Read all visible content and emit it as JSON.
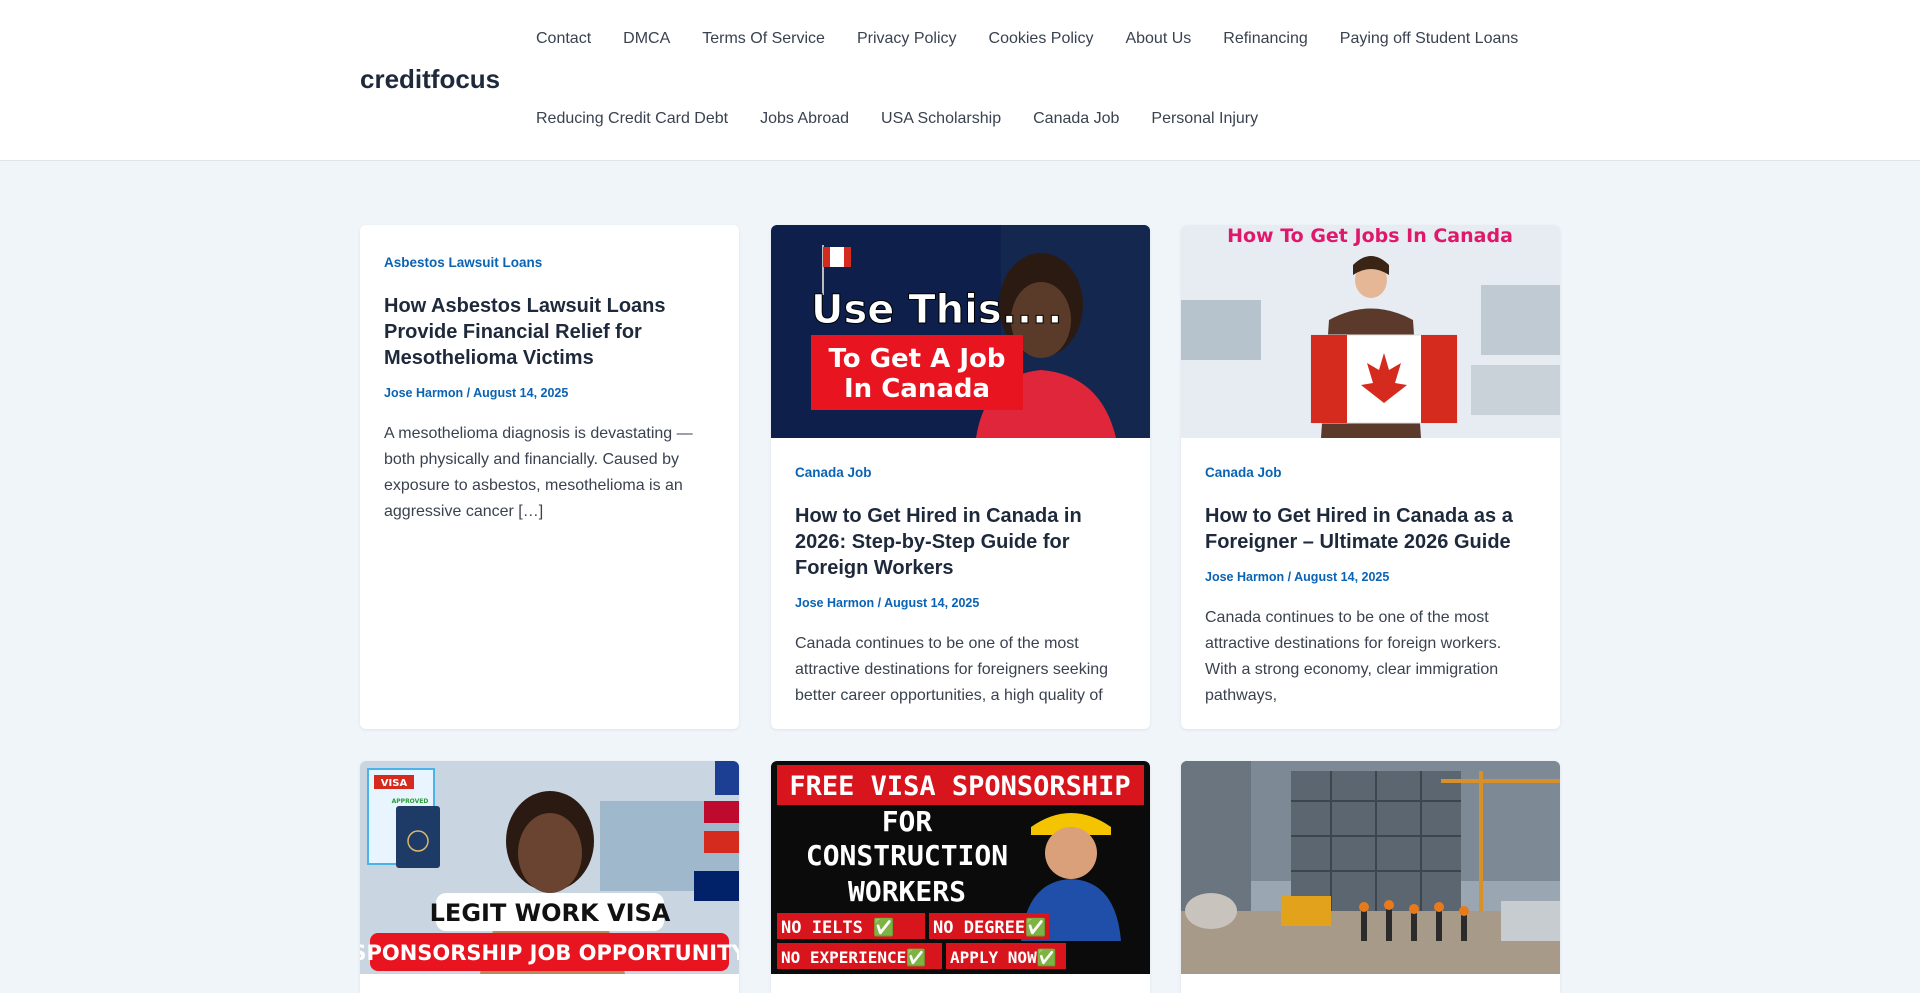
{
  "site": {
    "title": "creditfocus"
  },
  "nav": {
    "row1": [
      "Contact",
      "DMCA",
      "Terms Of Service",
      "Privacy Policy",
      "Cookies Policy",
      "About Us",
      "Refinancing",
      "Paying off Student Loans"
    ],
    "row2": [
      "Reducing Credit Card Debt",
      "Jobs Abroad",
      "USA Scholarship",
      "Canada Job",
      "Personal Injury"
    ]
  },
  "posts": [
    {
      "category": "Asbestos Lawsuit Loans",
      "title": "How Asbestos Lawsuit Loans Provide Financial Relief for Mesothelioma Victims",
      "meta": "Jose Harmon / August 14, 2025",
      "excerpt": "A mesothelioma diagnosis is devastating — both physically and financially. Caused by exposure to asbestos, mesothelioma is an aggressive cancer […]"
    },
    {
      "category": "Canada Job",
      "title": "How to Get Hired in Canada in 2026: Step-by-Step Guide for Foreign Workers",
      "meta": "Jose Harmon / August 14, 2025",
      "excerpt": "Canada continues to be one of the most attractive destinations for foreigners seeking better career opportunities, a high quality of",
      "thumb_text": [
        "Use This....",
        "To Get A Job",
        "In Canada"
      ]
    },
    {
      "category": "Canada Job",
      "title": "How to Get Hired in Canada as a Foreigner – Ultimate 2026 Guide",
      "meta": "Jose Harmon / August 14, 2025",
      "excerpt": "Canada continues to be one of the most attractive destinations for foreign workers. With a strong economy, clear immigration pathways,",
      "thumb_text": [
        "How To Get Jobs In Canada"
      ]
    },
    {
      "thumb_text": [
        "LEGIT WORK VISA",
        "SPONSORSHIP JOB OPPORTUNITY",
        "VISA",
        "APPROVED"
      ]
    },
    {
      "thumb_text": [
        "FREE VISA SPONSORSHIP",
        "FOR",
        "CONSTRUCTION",
        "WORKERS",
        "NO IELTS ✅",
        "NO DEGREE✅",
        "NO EXPERIENCE✅",
        "APPLY NOW✅"
      ]
    },
    {}
  ],
  "colors": {
    "background": "#f0f5fa",
    "accent": "#0a63b4",
    "heading": "#1e293b"
  }
}
